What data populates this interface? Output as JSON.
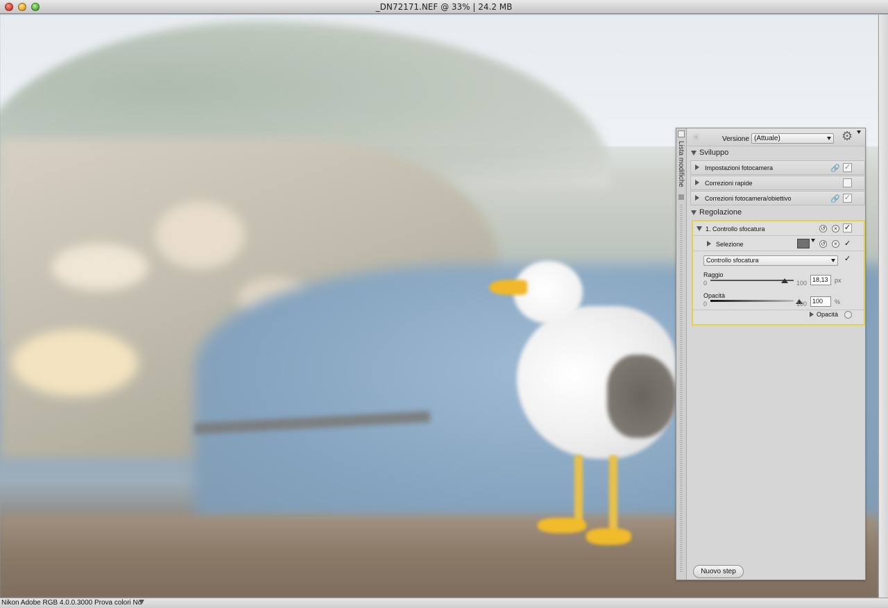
{
  "window": {
    "title": "_DN72171.NEF @ 33% | 24.2 MB"
  },
  "statusbar": {
    "text": "Nikon Adobe RGB 4.0.0.3000  Prova colori No"
  },
  "panel": {
    "side_tab_label": "Lista modifiche",
    "version_label": "Versione",
    "version_value": "(Attuale)",
    "sections": {
      "develop": {
        "label": "Sviluppo",
        "rows": [
          {
            "label": "Impostazioni fotocamera",
            "linked": true,
            "checked": true
          },
          {
            "label": "Correzioni rapide",
            "linked": false,
            "checked": false
          },
          {
            "label": "Correzioni fotocamera/obiettivo",
            "linked": true,
            "checked": true
          }
        ]
      },
      "adjust": {
        "label": "Regolazione",
        "step_title": "1. Controllo sfocatura",
        "selection_label": "Selezione",
        "filter_select": "Controllo sfocatura",
        "radius": {
          "label": "Raggio",
          "min": "0",
          "max": "100",
          "value": "18,13",
          "unit": "px"
        },
        "opacity": {
          "label": "Opacità",
          "min": "0",
          "max": "100",
          "value": "100",
          "unit": "%"
        },
        "opacity_toggle_label": "Opacità"
      }
    },
    "new_step_button": "Nuovo step"
  },
  "icons": {
    "gear": "gear-icon",
    "link": "link-icon",
    "reset": "reset-icon",
    "delete": "delete-icon"
  }
}
